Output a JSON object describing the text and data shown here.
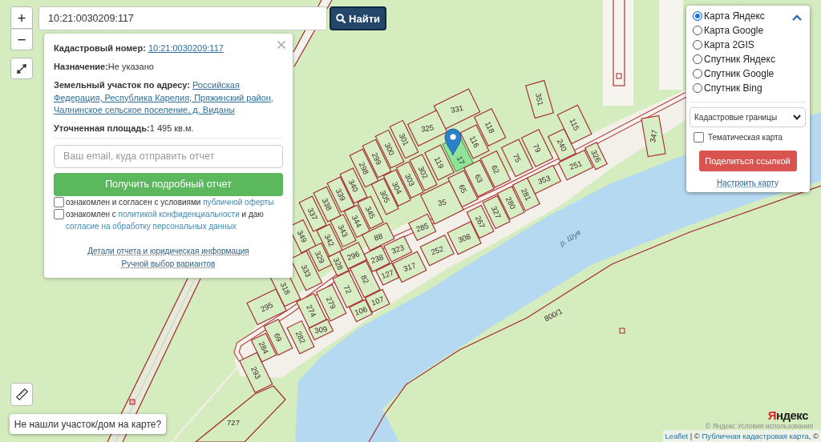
{
  "search": {
    "value": "10:21:0030209:117",
    "button": "Найти"
  },
  "zoom": {
    "zoom_in": "+",
    "zoom_out": "−"
  },
  "info_popup": {
    "rows": [
      {
        "kind": "link",
        "label": "Кадастровый номер:",
        "lines": [
          "10:21:0030209:117"
        ]
      },
      {
        "kind": "text",
        "label": "Назначение:",
        "lines": [
          "Не указано"
        ]
      },
      {
        "kind": "link",
        "label": "Земельный участок по адресу:",
        "lines": [
          "Российская",
          "Федерация, Республика Карелия, Пряжинский район,",
          "Чалнинское сельское поселение, д. Виданы"
        ]
      },
      {
        "kind": "text",
        "label": "Уточненная площадь:",
        "lines": [
          "1 495 кв.м."
        ]
      }
    ],
    "email": {
      "placeholder": "Ваш email, куда отправить отчет"
    },
    "report_button": "Получить подробный отчет",
    "consents": [
      {
        "checked": false,
        "parts": [
          {
            "kind": "text",
            "text": "ознакомлен и согласен с условиями "
          },
          {
            "kind": "link",
            "text": "публичной оферты"
          }
        ]
      },
      {
        "checked": false,
        "parts": [
          {
            "kind": "text",
            "text": "ознакомлен с "
          },
          {
            "kind": "link",
            "text": "политикой конфиденциальности"
          },
          {
            "kind": "text",
            "text": " и даю "
          },
          {
            "kind": "link",
            "text": "согласие на обработку персональных данных"
          }
        ]
      }
    ],
    "links": [
      "Детали отчета и юридическая информация",
      "Ручной выбор вариантов"
    ]
  },
  "layers": {
    "expanded": true,
    "base_maps": [
      {
        "label": "Карта Яндекс",
        "selected": true
      },
      {
        "label": "Карта Google",
        "selected": false
      },
      {
        "label": "Карта 2GIS",
        "selected": false
      },
      {
        "label": "Спутник Яндекс",
        "selected": false
      },
      {
        "label": "Спутник Google",
        "selected": false
      },
      {
        "label": "Спутник Bing",
        "selected": false
      }
    ],
    "overlay": {
      "value": "Кадастровые границы"
    },
    "thematic": {
      "label": "Тематическая карта",
      "checked": false
    },
    "share_button": "Поделиться ссылкой",
    "settings_link": "Настроить карту"
  },
  "map": {
    "parcels": [
      {
        "label": "331",
        "selected": false
      },
      {
        "label": "325",
        "selected": false
      },
      {
        "label": "17",
        "selected": true
      },
      {
        "label": "116",
        "selected": false
      },
      {
        "label": "118",
        "selected": false
      },
      {
        "label": "351",
        "selected": false
      },
      {
        "label": "301",
        "selected": false
      },
      {
        "label": "300",
        "selected": false
      },
      {
        "label": "299",
        "selected": false
      },
      {
        "label": "298",
        "selected": false
      },
      {
        "label": "119",
        "selected": false
      },
      {
        "label": "302",
        "selected": false
      },
      {
        "label": "303",
        "selected": false
      },
      {
        "label": "304",
        "selected": false
      },
      {
        "label": "305",
        "selected": false
      },
      {
        "label": "35",
        "selected": false
      },
      {
        "label": "65",
        "selected": false
      },
      {
        "label": "63",
        "selected": false
      },
      {
        "label": "62",
        "selected": false
      },
      {
        "label": "75",
        "selected": false
      },
      {
        "label": "79",
        "selected": false
      },
      {
        "label": "240",
        "selected": false
      },
      {
        "label": "115",
        "selected": false
      },
      {
        "label": "326",
        "selected": false
      },
      {
        "label": "251",
        "selected": false
      },
      {
        "label": "353",
        "selected": false
      },
      {
        "label": "281",
        "selected": false
      },
      {
        "label": "280",
        "selected": false
      },
      {
        "label": "327",
        "selected": false
      },
      {
        "label": "267",
        "selected": false
      },
      {
        "label": "308",
        "selected": false
      },
      {
        "label": "252",
        "selected": false
      },
      {
        "label": "285",
        "selected": false
      },
      {
        "label": "340",
        "selected": false
      },
      {
        "label": "339",
        "selected": false
      },
      {
        "label": "338",
        "selected": false
      },
      {
        "label": "337",
        "selected": false
      },
      {
        "label": "345",
        "selected": false
      },
      {
        "label": "344",
        "selected": false
      },
      {
        "label": "343",
        "selected": false
      },
      {
        "label": "342",
        "selected": false
      },
      {
        "label": "349",
        "selected": false
      },
      {
        "label": "329",
        "selected": false
      },
      {
        "label": "328",
        "selected": false
      },
      {
        "label": "296",
        "selected": false
      },
      {
        "label": "88",
        "selected": false
      },
      {
        "label": "323",
        "selected": false
      },
      {
        "label": "238",
        "selected": false
      },
      {
        "label": "317",
        "selected": false
      },
      {
        "label": "127",
        "selected": false
      },
      {
        "label": "82",
        "selected": false
      },
      {
        "label": "333",
        "selected": false
      },
      {
        "label": "318",
        "selected": false
      },
      {
        "label": "72",
        "selected": false
      },
      {
        "label": "106",
        "selected": false
      },
      {
        "label": "107",
        "selected": false
      },
      {
        "label": "295",
        "selected": false
      },
      {
        "label": "274",
        "selected": false
      },
      {
        "label": "279",
        "selected": false
      },
      {
        "label": "309",
        "selected": false
      },
      {
        "label": "69",
        "selected": false
      },
      {
        "label": "282",
        "selected": false
      },
      {
        "label": "284",
        "selected": false
      },
      {
        "label": "293",
        "selected": false
      },
      {
        "label": "347",
        "selected": false
      }
    ],
    "boundary_labels": [
      "800/1",
      "727"
    ],
    "river_label": "р. Шуя"
  },
  "not_found_button": "Не нашли участок/дом на карте?",
  "yandex": {
    "logo": "Яндекс",
    "terms": "© Яндекс Условия использования"
  },
  "attribution": [
    {
      "kind": "link",
      "text": "Leaflet"
    },
    {
      "kind": "text",
      "text": " | © "
    },
    {
      "kind": "link",
      "text": "Публичная кадастровая карта"
    },
    {
      "kind": "text",
      "text": ", ©"
    }
  ]
}
